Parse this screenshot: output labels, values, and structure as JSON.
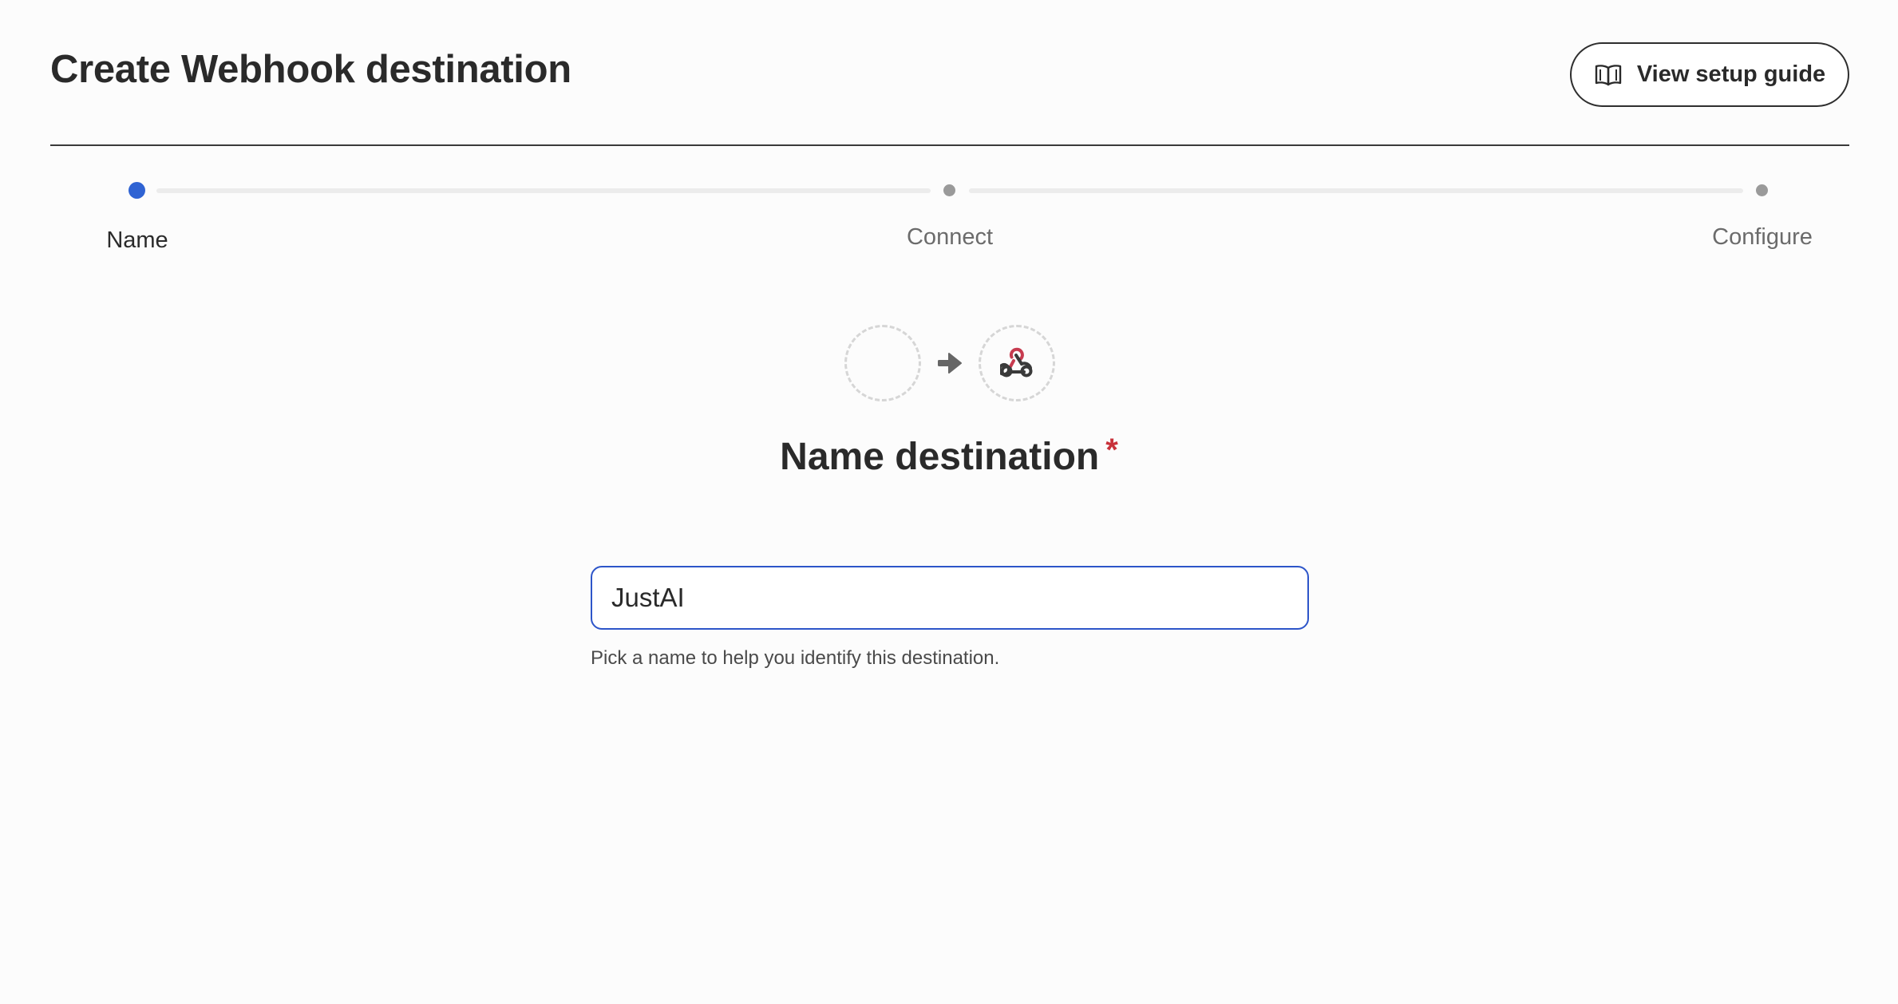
{
  "header": {
    "title": "Create Webhook destination",
    "guide_button_label": "View setup guide",
    "guide_icon": "book-icon"
  },
  "stepper": {
    "steps": [
      {
        "label": "Name",
        "state": "active"
      },
      {
        "label": "Connect",
        "state": "inactive"
      },
      {
        "label": "Configure",
        "state": "inactive"
      }
    ],
    "active_color": "#2f63d3",
    "inactive_color": "#9a9a9a"
  },
  "graphic": {
    "source_icon": "empty-source-circle",
    "arrow_icon": "arrow-right-icon",
    "destination_icon": "webhook-icon"
  },
  "form": {
    "title": "Name destination",
    "required_marker": "*",
    "input_value": "JustAI",
    "helper_text": "Pick a name to help you identify this destination."
  },
  "colors": {
    "accent": "#2d55c9",
    "required": "#c8323a",
    "webhook_red": "#c73b4f"
  }
}
